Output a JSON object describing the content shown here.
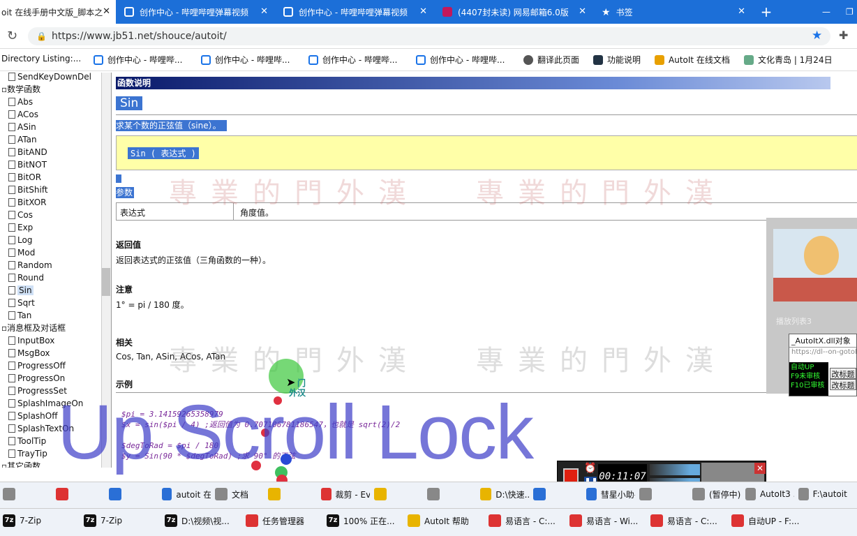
{
  "tabs": [
    {
      "title": "oit 在线手册中文版_脚本之",
      "icon": "doc"
    },
    {
      "title": "创作中心 - 哔哩哔哩弹幕视频",
      "icon": "bilibili"
    },
    {
      "title": "创作中心 - 哔哩哔哩弹幕视频",
      "icon": "bilibili"
    },
    {
      "title": "(4407封未读) 网易邮箱6.0版",
      "icon": "mail"
    },
    {
      "title": "书签",
      "icon": "star"
    }
  ],
  "new_tab": "+",
  "window_controls": {
    "minimize": "—",
    "maximize": "❐",
    "close": "✕"
  },
  "url": "https://www.jb51.net/shouce/autoit/",
  "bookmarks": [
    "Directory Listing:...",
    "创作中心 - 哔哩哔...",
    "创作中心 - 哔哩哔...",
    "创作中心 - 哔哩哔...",
    "创作中心 - 哔哩哔...",
    "翻译此页面",
    "功能说明",
    "AutoIt 在线文档",
    "文化青岛 | 1月24日"
  ],
  "tree": [
    {
      "label": "SendKeyDownDel",
      "indent": 1
    },
    {
      "label": "数学函数",
      "indent": 0
    },
    {
      "label": "Abs",
      "indent": 1
    },
    {
      "label": "ACos",
      "indent": 1
    },
    {
      "label": "ASin",
      "indent": 1
    },
    {
      "label": "ATan",
      "indent": 1
    },
    {
      "label": "BitAND",
      "indent": 1
    },
    {
      "label": "BitNOT",
      "indent": 1
    },
    {
      "label": "BitOR",
      "indent": 1
    },
    {
      "label": "BitShift",
      "indent": 1
    },
    {
      "label": "BitXOR",
      "indent": 1
    },
    {
      "label": "Cos",
      "indent": 1
    },
    {
      "label": "Exp",
      "indent": 1
    },
    {
      "label": "Log",
      "indent": 1
    },
    {
      "label": "Mod",
      "indent": 1
    },
    {
      "label": "Random",
      "indent": 1
    },
    {
      "label": "Round",
      "indent": 1
    },
    {
      "label": "Sin",
      "indent": 1,
      "selected": true
    },
    {
      "label": "Sqrt",
      "indent": 1
    },
    {
      "label": "Tan",
      "indent": 1
    },
    {
      "label": "消息框及对话框",
      "indent": 0
    },
    {
      "label": "InputBox",
      "indent": 1
    },
    {
      "label": "MsgBox",
      "indent": 1
    },
    {
      "label": "ProgressOff",
      "indent": 1
    },
    {
      "label": "ProgressOn",
      "indent": 1
    },
    {
      "label": "ProgressSet",
      "indent": 1
    },
    {
      "label": "SplashImageOn",
      "indent": 1
    },
    {
      "label": "SplashOff",
      "indent": 1
    },
    {
      "label": "SplashTextOn",
      "indent": 1
    },
    {
      "label": "ToolTip",
      "indent": 1
    },
    {
      "label": "TrayTip",
      "indent": 1
    },
    {
      "label": "其它函数",
      "indent": 0
    }
  ],
  "doc": {
    "header": "函数说明",
    "func_name": "Sin",
    "desc": "求某个数的正弦值（sine）。",
    "syntax": "Sin ( 表达式 )",
    "params_label": "参数",
    "param_name": "表达式",
    "param_desc": "角度值。",
    "return_label": "返回值",
    "return_text": "返回表达式的正弦值（三角函数的一种）。",
    "note_label": "注意",
    "note_text": "1° = pi / 180 度。",
    "related_label": "相关",
    "related_text": "Cos, Tan, ASin, ACos, ATan",
    "example_label": "示例",
    "code": [
      "$pi = 3.14159265358979",
      "$x = sin($pi / 4)   ;返回值为 0.707106781186547，也就是 sqrt(2)/2",
      "",
      "$degToRad = $pi / 180",
      "$y = Sin(90 * $degToRad)   ;求 90° 的正弦"
    ]
  },
  "watermark": "專業的門外漢",
  "cursor_label": [
    "门",
    "外汉"
  ],
  "scroll_lock": "Up Scroll Lock",
  "overlay": {
    "playlist": "播放列表3",
    "autoit_title": "_AutoItX.dll对象",
    "autoit_url": "https://dl--on-gotohal",
    "status_lines": [
      "自动UP",
      "F9未审核",
      "F10已审核"
    ],
    "btn1": "改标题",
    "btn2": "改标题"
  },
  "recorder_time": "00:11:07",
  "taskbar1": [
    {
      "label": "",
      "icon": "grey"
    },
    {
      "label": "",
      "icon": "red"
    },
    {
      "label": "",
      "icon": "blue"
    },
    {
      "label": "autoit 在...",
      "icon": "chrome"
    },
    {
      "label": "文档",
      "icon": "doc"
    },
    {
      "label": "",
      "icon": "yel"
    },
    {
      "label": "裁剪 - Ev...",
      "icon": "search"
    },
    {
      "label": "",
      "icon": "yel"
    },
    {
      "label": "",
      "icon": "grey"
    },
    {
      "label": "D:\\快速...",
      "icon": "yel"
    },
    {
      "label": "",
      "icon": "blue"
    },
    {
      "label": "彗星小助手",
      "icon": "blue"
    },
    {
      "label": "",
      "icon": "grey"
    },
    {
      "label": "(暂停中)",
      "icon": "grey"
    },
    {
      "label": "AutoIt3 ...",
      "icon": "grey"
    },
    {
      "label": "F:\\autoit...",
      "icon": "grey"
    }
  ],
  "taskbar2": [
    {
      "label": "7-Zip",
      "icon": "7z"
    },
    {
      "label": "7-Zip",
      "icon": "7z"
    },
    {
      "label": "D:\\视频\\视...",
      "icon": "7z"
    },
    {
      "label": "任务管理器",
      "icon": "red"
    },
    {
      "label": "100% 正在...",
      "icon": "7z"
    },
    {
      "label": "AutoIt 帮助",
      "icon": "yel"
    },
    {
      "label": "易语言 - C:...",
      "icon": "red"
    },
    {
      "label": "易语言 - Wi...",
      "icon": "red"
    },
    {
      "label": "易语言 - C:...",
      "icon": "red"
    },
    {
      "label": "自动UP - F:...",
      "icon": "red"
    }
  ]
}
